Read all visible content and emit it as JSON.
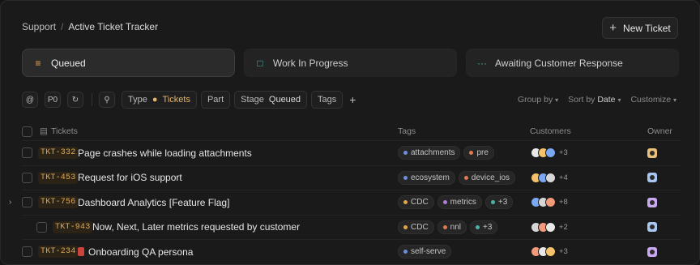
{
  "breadcrumb": {
    "root": "Support",
    "separator": "/",
    "current": "Active Ticket Tracker"
  },
  "new_ticket": {
    "label": "New Ticket"
  },
  "stages": [
    {
      "label": "Queued",
      "icon": "queue-icon",
      "active": true
    },
    {
      "label": "Work In Progress",
      "icon": "chat-icon",
      "active": false
    },
    {
      "label": "Awaiting Customer Response",
      "icon": "ellipsis-icon",
      "active": false
    }
  ],
  "filters": {
    "mention": "@",
    "priority": "P0",
    "type_label": "Type",
    "type_value": "Tickets",
    "part_label": "Part",
    "stage_label": "Stage",
    "stage_value": "Queued",
    "tags_label": "Tags",
    "group_by": "Group by",
    "sort_by": "Sort by",
    "sort_value": "Date",
    "customize": "Customize"
  },
  "columns": {
    "tickets": "Tickets",
    "tags": "Tags",
    "customers": "Customers",
    "owner": "Owner"
  },
  "rows": [
    {
      "id": "TKT-332",
      "title": "Page crashes while loading attachments",
      "tags": [
        {
          "label": "attachments",
          "color": "#6f8fd6"
        },
        {
          "label": "pre",
          "color": "#e07a4d"
        }
      ],
      "customers_more": "+3",
      "owner_color": "#e8c07a",
      "indent": false,
      "expandable": false,
      "doc": false
    },
    {
      "id": "TKT-453",
      "title": "Request for iOS support",
      "tags": [
        {
          "label": "ecosystem",
          "color": "#6f8fd6"
        },
        {
          "label": "device_ios",
          "color": "#e07a4d"
        }
      ],
      "customers_more": "+4",
      "owner_color": "#a9c6f2",
      "indent": false,
      "expandable": false,
      "doc": false
    },
    {
      "id": "TKT-756",
      "title": "Dashboard Analytics [Feature Flag]",
      "tags": [
        {
          "label": "CDC",
          "color": "#e0a84d"
        },
        {
          "label": "metrics",
          "color": "#b27ad6"
        },
        {
          "label": "+3",
          "color": "#4cb3a6"
        }
      ],
      "customers_more": "+8",
      "owner_color": "#c9a9f2",
      "indent": false,
      "expandable": true,
      "doc": false
    },
    {
      "id": "TKT-943",
      "title": "Now, Next, Later metrics requested by customer",
      "tags": [
        {
          "label": "CDC",
          "color": "#e0a84d"
        },
        {
          "label": "nnl",
          "color": "#e07a4d"
        },
        {
          "label": "+3",
          "color": "#4cb3a6"
        }
      ],
      "customers_more": "+2",
      "owner_color": "#a9c6f2",
      "indent": true,
      "expandable": false,
      "doc": false
    },
    {
      "id": "TKT-234",
      "title": "Onboarding QA persona",
      "tags": [
        {
          "label": "self-serve",
          "color": "#6f8fd6"
        }
      ],
      "customers_more": "+3",
      "owner_color": "#c9a9f2",
      "indent": false,
      "expandable": false,
      "doc": true
    }
  ]
}
